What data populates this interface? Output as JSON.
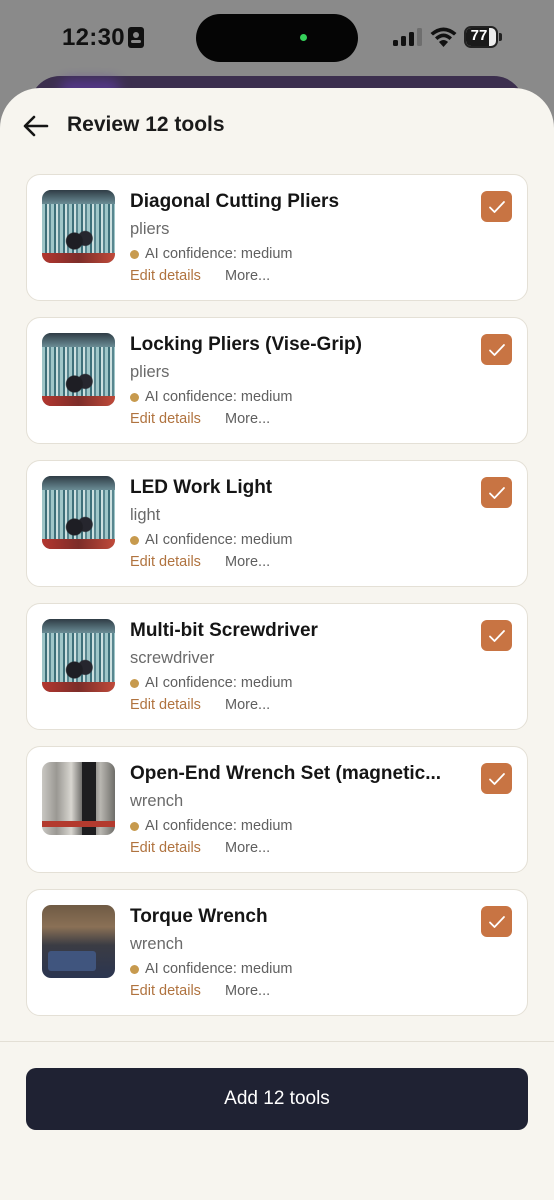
{
  "status_bar": {
    "time": "12:30",
    "battery": "77",
    "battery_level": 0.77
  },
  "header": {
    "title": "Review 12 tools",
    "back_icon": "arrow-left-icon"
  },
  "tools": [
    {
      "name": "Diagonal Cutting Pliers",
      "category": "pliers",
      "confidence": "AI confidence: medium",
      "edit_label": "Edit details",
      "more_label": "More...",
      "checked": true,
      "thumbnail": "pliers-photo"
    },
    {
      "name": "Locking Pliers (Vise-Grip)",
      "category": "pliers",
      "confidence": "AI confidence: medium",
      "edit_label": "Edit details",
      "more_label": "More...",
      "checked": true,
      "thumbnail": "pliers-photo"
    },
    {
      "name": "LED Work Light",
      "category": "light",
      "confidence": "AI confidence: medium",
      "edit_label": "Edit details",
      "more_label": "More...",
      "checked": true,
      "thumbnail": "pliers-photo"
    },
    {
      "name": "Multi-bit Screwdriver",
      "category": "screwdriver",
      "confidence": "AI confidence: medium",
      "edit_label": "Edit details",
      "more_label": "More...",
      "checked": true,
      "thumbnail": "pliers-photo"
    },
    {
      "name": "Open-End Wrench Set (magnetic...",
      "category": "wrench",
      "confidence": "AI confidence: medium",
      "edit_label": "Edit details",
      "more_label": "More...",
      "checked": true,
      "thumbnail": "wrench-photo"
    },
    {
      "name": "Torque Wrench",
      "category": "wrench",
      "confidence": "AI confidence: medium",
      "edit_label": "Edit details",
      "more_label": "More...",
      "checked": true,
      "thumbnail": "torque-wrench-photo"
    }
  ],
  "footer": {
    "add_button": "Add 12 tools"
  },
  "colors": {
    "accent": "#c87443",
    "link": "#b0733f",
    "confidence_dot": "#c79a4e",
    "primary_button": "#1f2233",
    "sheet_background": "#f7f5ef"
  }
}
